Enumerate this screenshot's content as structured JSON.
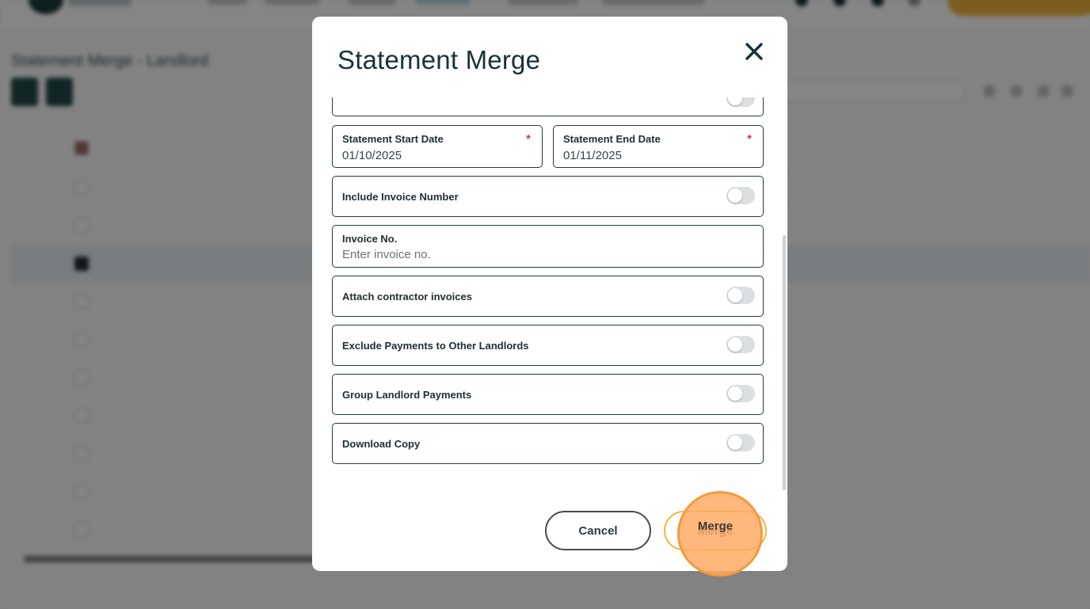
{
  "modal": {
    "title": "Statement Merge",
    "fields": {
      "start_date": {
        "label": "Statement Start Date",
        "value": "01/10/2025",
        "required_mark": "*"
      },
      "end_date": {
        "label": "Statement End Date",
        "value": "01/11/2025",
        "required_mark": "*"
      },
      "invoice_no": {
        "label": "Invoice No.",
        "placeholder": "Enter invoice no."
      }
    },
    "toggles": {
      "include_invoice_number": {
        "label": "Include Invoice Number",
        "on": false
      },
      "attach_contractor_invoices": {
        "label": "Attach contractor invoices",
        "on": false
      },
      "exclude_payments": {
        "label": "Exclude Payments to Other Landlords",
        "on": false
      },
      "group_landlord_payments": {
        "label": "Group Landlord Payments",
        "on": false
      },
      "download_copy": {
        "label": "Download Copy",
        "on": false
      }
    },
    "buttons": {
      "cancel": "Cancel",
      "merge": "Merge"
    }
  },
  "background": {
    "page_title": "Statement Merge - Landlord"
  },
  "colors": {
    "primary_dark": "#1f3d40",
    "accent": "#f2b63f",
    "required": "#d23a3a",
    "highlight": "#f39a3c"
  }
}
